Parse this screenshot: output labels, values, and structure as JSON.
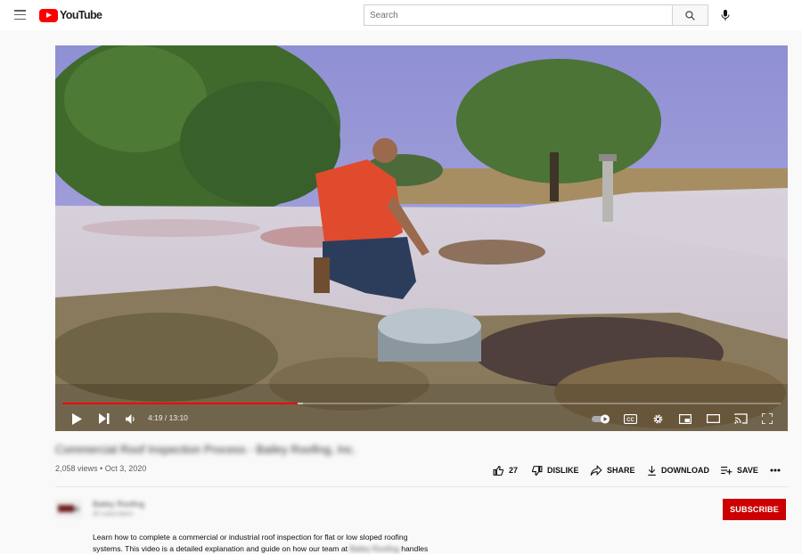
{
  "masthead": {
    "logo_text": "YouTube",
    "search_placeholder": "Search",
    "icons": [
      "hamburger-menu-icon",
      "search-icon",
      "microphone-icon"
    ]
  },
  "player": {
    "current_time": "4:19",
    "duration": "13:10",
    "progress_played": 0.328,
    "progress_buffered": 0.335,
    "controls": [
      "play-icon",
      "next-icon",
      "volume-icon",
      "autoplay-toggle-icon",
      "captions-icon",
      "settings-icon",
      "miniplayer-icon",
      "theater-mode-icon",
      "cast-icon",
      "fullscreen-icon"
    ],
    "captions_label": "CC"
  },
  "video": {
    "title": "Commercial Roof Inspection Process - Bailey Roofing, Inc.",
    "views": "2,058 views",
    "separator": "•",
    "date": "Oct 3, 2020",
    "actions": {
      "like_count": "27",
      "dislike_label": "DISLIKE",
      "share_label": "SHARE",
      "download_label": "DOWNLOAD",
      "save_label": "SAVE"
    }
  },
  "channel": {
    "name": "Bailey Roofing",
    "subscribers": "40 subscribers",
    "subscribe_label": "SUBSCRIBE"
  },
  "description": {
    "line1": "Learn how to complete a commercial or industrial roof inspection for flat or low sloped roofing",
    "line2_start": "systems. This video is a detailed explanation and guide on how our team at",
    "line2_blurred": "Bailey Roofing",
    "line2_end": "handles"
  },
  "colors": {
    "accent_red": "#ff0000",
    "subscribe_red": "#cc0000",
    "page_bg": "#f9f9f9"
  }
}
